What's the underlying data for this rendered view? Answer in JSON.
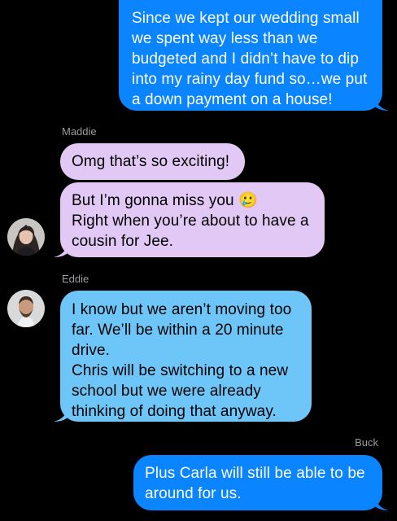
{
  "thread": {
    "messages": [
      {
        "sender": "",
        "text": "Since we kept our wedding small\nwe spent way less than we\nbudgeted and I didn’t have to dip\ninto my rainy day fund so…we put\na down payment on a house!"
      },
      {
        "sender": "Maddie",
        "text": "Omg that’s so exciting!"
      },
      {
        "sender": "",
        "text": "But I’m gonna miss you 🥲\nRight when you’re about to have a\ncousin for Jee."
      },
      {
        "sender": "Eddie",
        "text": "I know but we aren’t moving too\nfar. We’ll be within a 20 minute\ndrive.\nChris will be switching to a new\nschool but we were already\nthinking of doing that anyway."
      },
      {
        "sender": "Buck",
        "text": "Plus Carla will still be able to be\naround for us."
      }
    ]
  },
  "colors": {
    "background": "#000000",
    "outgoing_bubble": "#0a84ff",
    "maddie_bubble": "#e2c8f4",
    "eddie_bubble": "#6ec6f8",
    "sender_label": "#9a9a9f"
  },
  "icons": {
    "maddie_avatar": "avatar-photo",
    "eddie_avatar": "avatar-photo"
  }
}
